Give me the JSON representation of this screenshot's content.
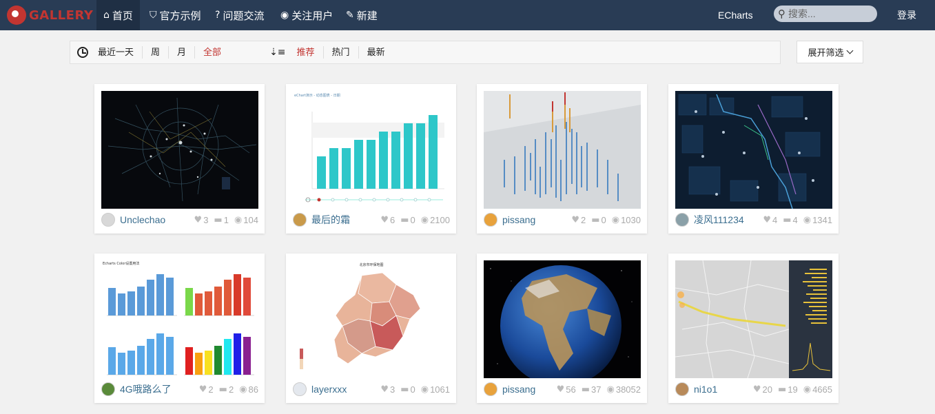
{
  "nav": {
    "logo_text": "GALLERY",
    "items": [
      {
        "label": "首页",
        "icon": "home-icon",
        "glyph": "⌂"
      },
      {
        "label": "官方示例",
        "icon": "shield-icon",
        "glyph": "⛉"
      },
      {
        "label": "问题交流",
        "icon": "question-icon",
        "glyph": "?"
      },
      {
        "label": "关注用户",
        "icon": "eye-icon",
        "glyph": "◉"
      },
      {
        "label": "新建",
        "icon": "edit-icon",
        "glyph": "✎"
      }
    ],
    "echarts_link": "ECharts",
    "search_placeholder": "搜索...",
    "login": "登录"
  },
  "filters": {
    "time": [
      "最近一天",
      "周",
      "月",
      "全部"
    ],
    "time_active": "全部",
    "sort": [
      "推荐",
      "热门",
      "最新"
    ],
    "sort_active": "推荐",
    "expand_label": "展开筛选"
  },
  "colors": {
    "navbar": "#293c55",
    "accent_red": "#c23531",
    "author_link": "#3b6e8f",
    "bar_teal": "#2ec7c9"
  },
  "cards": [
    {
      "author": "Unclechao",
      "likes": "3",
      "comments": "1",
      "views": "104",
      "thumb": "dark-network"
    },
    {
      "author": "最后的霜",
      "likes": "6",
      "comments": "0",
      "views": "2100",
      "thumb": "teal-bar-chart"
    },
    {
      "author": "pissang",
      "likes": "2",
      "comments": "0",
      "views": "1030",
      "thumb": "3d-city-bars"
    },
    {
      "author": "凌风111234",
      "likes": "4",
      "comments": "4",
      "views": "1341",
      "thumb": "navy-city-map"
    },
    {
      "author": "4G哦路么了",
      "likes": "2",
      "comments": "2",
      "views": "86",
      "thumb": "four-color-bar-charts"
    },
    {
      "author": "layerxxx",
      "likes": "3",
      "comments": "0",
      "views": "1061",
      "thumb": "beijing-choropleth"
    },
    {
      "author": "pissang",
      "likes": "56",
      "comments": "37",
      "views": "38052",
      "thumb": "earth-globe"
    },
    {
      "author": "ni1o1",
      "likes": "20",
      "comments": "19",
      "views": "4665",
      "thumb": "grey-map-dashboard"
    }
  ],
  "thumb_text": {
    "bar_title": "eChart演示 - 动态图表 - 日期",
    "colors_title": "Echarts Color设置用法",
    "map_title": "北京市环保地图"
  }
}
